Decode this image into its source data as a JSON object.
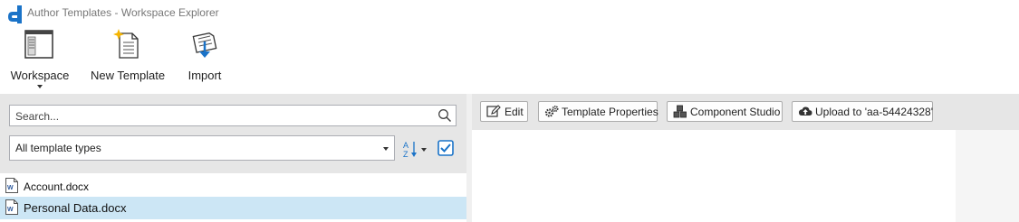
{
  "window": {
    "title": "Author Templates - Workspace Explorer"
  },
  "ribbon": {
    "workspace_label": "Workspace",
    "new_template_label": "New Template",
    "import_label": "Import"
  },
  "left": {
    "search_placeholder": "Search...",
    "type_filter_value": "All template types",
    "files": [
      {
        "name": "Account.docx",
        "selected": false
      },
      {
        "name": "Personal Data.docx",
        "selected": true
      }
    ]
  },
  "right": {
    "edit_label": "Edit",
    "template_properties_label": "Template Properties",
    "component_studio_label": "Component Studio",
    "upload_label": "Upload to 'aa-54424328'"
  },
  "colors": {
    "brand": "#1a73c8",
    "toolbar_bg": "#e6e6e6",
    "selection_bg": "#cce6f5"
  }
}
